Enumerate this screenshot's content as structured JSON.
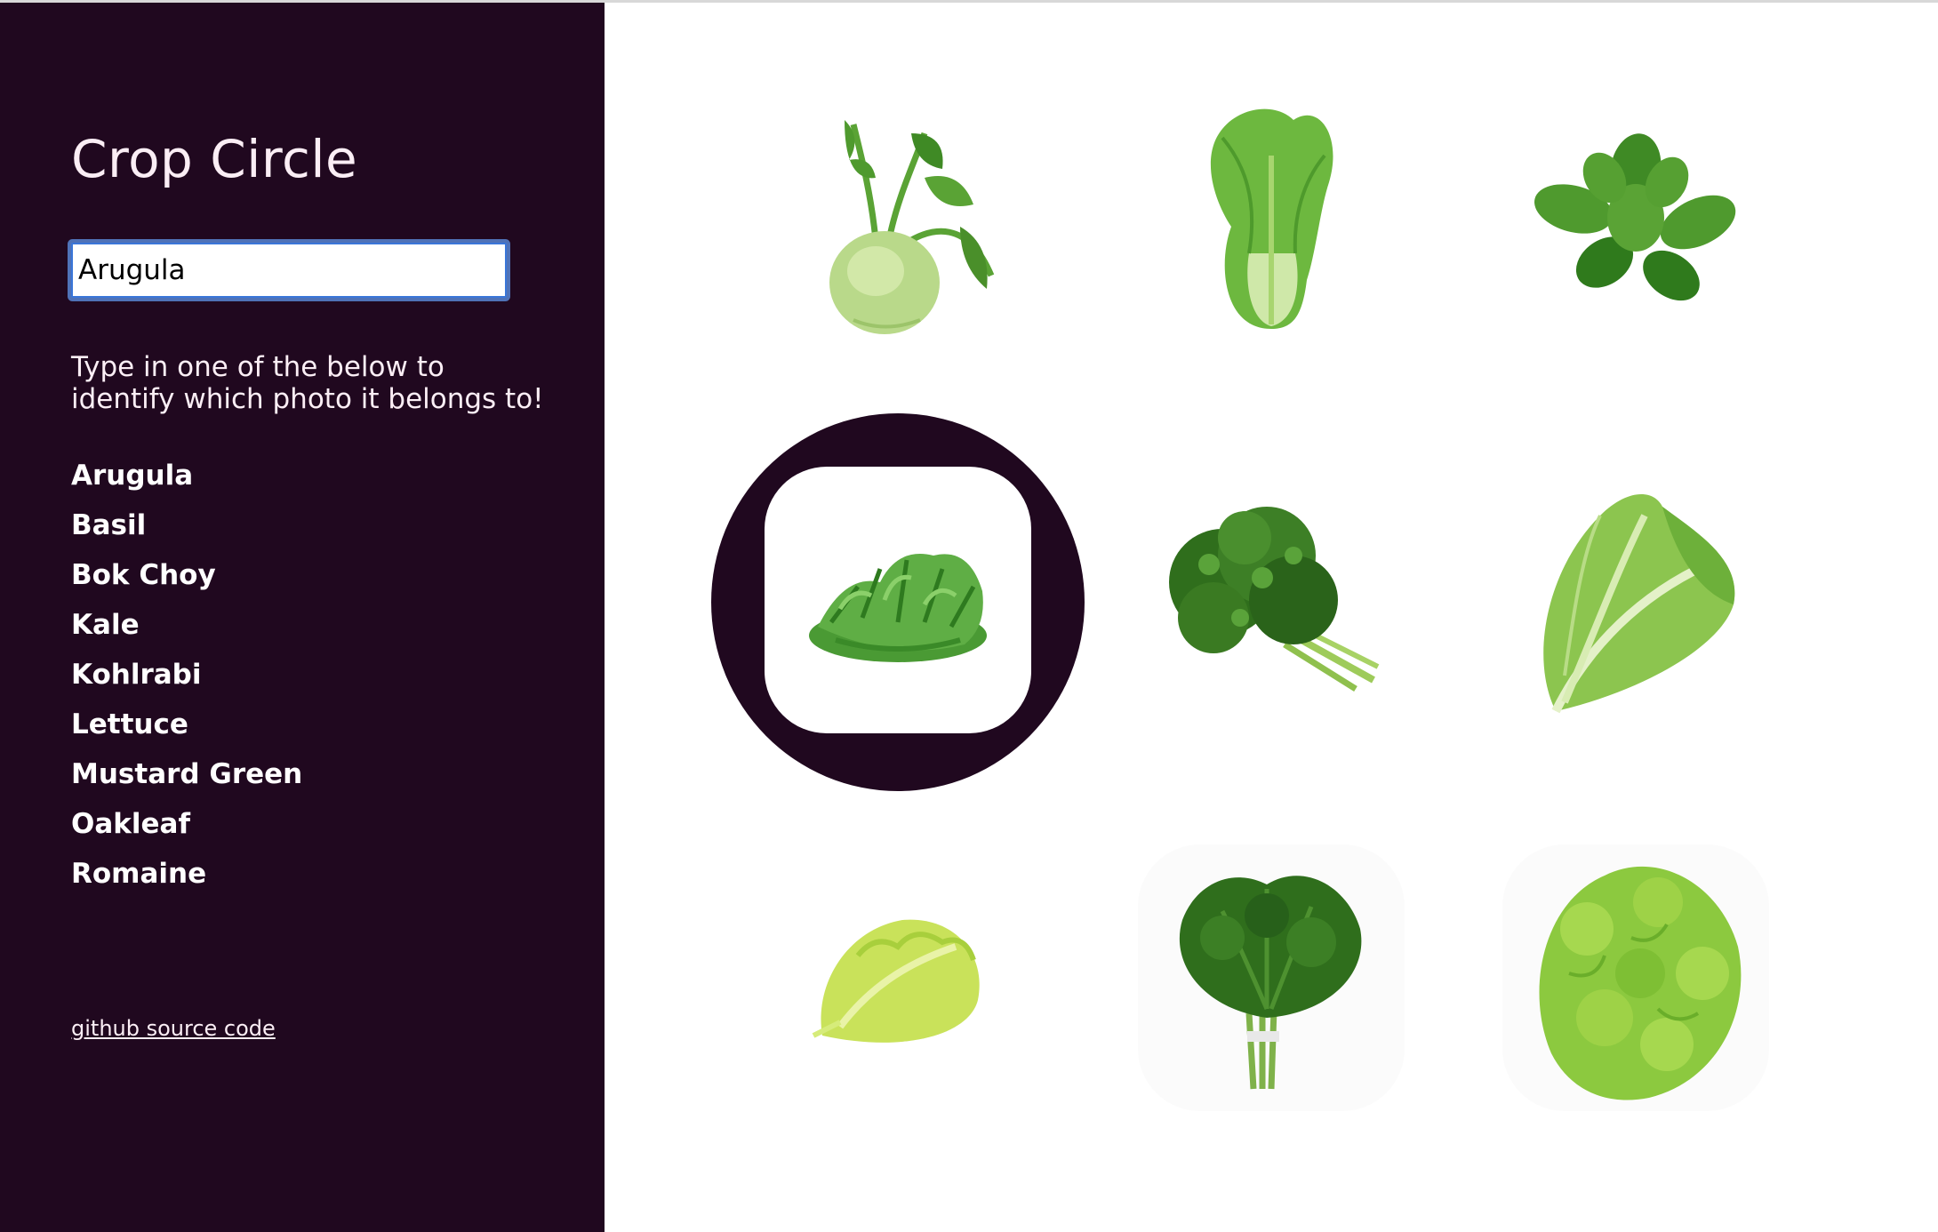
{
  "app": {
    "title": "Crop Circle"
  },
  "search": {
    "value": "Arugula"
  },
  "instructions": "Type in one of the below to identify which photo it belongs to!",
  "options": [
    "Arugula",
    "Basil",
    "Bok Choy",
    "Kale",
    "Kohlrabi",
    "Lettuce",
    "Mustard Green",
    "Oakleaf",
    "Romaine"
  ],
  "footer": {
    "link_label": "github source code"
  },
  "grid": [
    {
      "icon": "kohlrabi-icon"
    },
    {
      "icon": "bok-choy-icon"
    },
    {
      "icon": "basil-icon"
    },
    {
      "icon": "arugula-icon",
      "selected": true
    },
    {
      "icon": "kale-icon"
    },
    {
      "icon": "romaine-icon"
    },
    {
      "icon": "lettuce-icon"
    },
    {
      "icon": "mustard-green-icon"
    },
    {
      "icon": "oakleaf-icon"
    }
  ],
  "colors": {
    "sidebar": "#20081f",
    "accent_focus": "#3a76d8",
    "leaf_green": "#4f9a2e"
  }
}
